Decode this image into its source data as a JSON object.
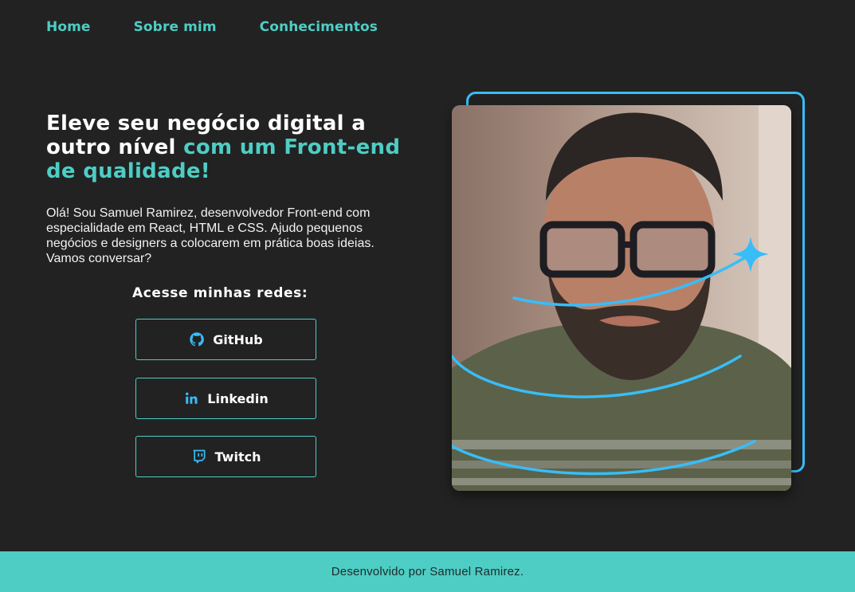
{
  "nav": {
    "items": [
      "Home",
      "Sobre mim",
      "Conhecimentos"
    ]
  },
  "hero": {
    "headline_part1": "Eleve seu negócio digital a outro nível ",
    "headline_accent": "com um Front-end de qualidade!",
    "intro": "Olá! Sou Samuel Ramirez, desenvolvedor Front-end com especialidade em React, HTML e CSS. Ajudo pequenos negócios e designers a colocarem em prática boas ideias. Vamos conversar?",
    "socials_title": "Acesse minhas redes:",
    "socials": [
      {
        "label": "GitHub",
        "icon": "github-icon"
      },
      {
        "label": "Linkedin",
        "icon": "linkedin-icon"
      },
      {
        "label": "Twitch",
        "icon": "twitch-icon"
      }
    ]
  },
  "footer": {
    "text": "Desenvolvido por Samuel Ramirez."
  },
  "colors": {
    "background": "#222222",
    "accent": "#4ecdc4",
    "frame": "#38bdf8"
  }
}
